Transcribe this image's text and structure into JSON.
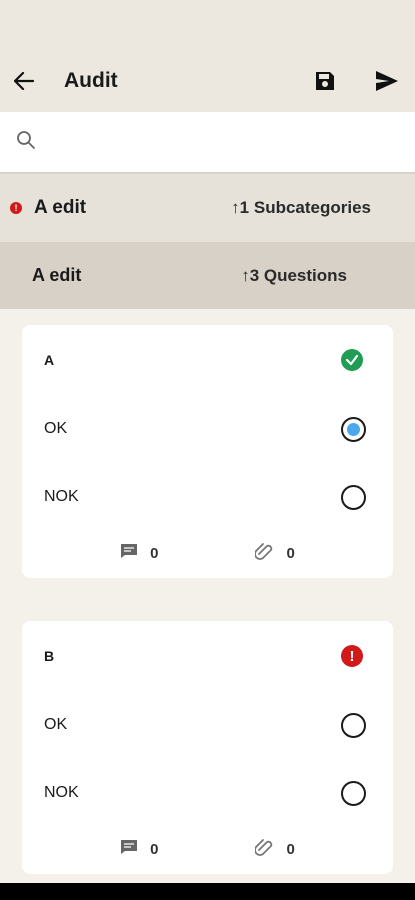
{
  "app_bar": {
    "title": "Audit"
  },
  "search": {
    "placeholder": "",
    "value": ""
  },
  "category": {
    "name": "A edit",
    "count_label": "↑1 Subcategories"
  },
  "subcategory": {
    "name": "A edit",
    "count_label": "↑3 Questions"
  },
  "questions": [
    {
      "label": "A",
      "status": "ok",
      "options": [
        {
          "label": "OK",
          "selected": true
        },
        {
          "label": "NOK",
          "selected": false
        }
      ],
      "comments": "0",
      "attachments": "0"
    },
    {
      "label": "B",
      "status": "error",
      "options": [
        {
          "label": "OK",
          "selected": false
        },
        {
          "label": "NOK",
          "selected": false
        }
      ],
      "comments": "0",
      "attachments": "0"
    }
  ],
  "colors": {
    "accent": "#4aa8ec",
    "ok": "#1f9d55",
    "error": "#d21919"
  },
  "icons": [
    "back-arrow-icon",
    "save-icon",
    "send-icon",
    "search-icon",
    "comment-icon",
    "attachment-icon"
  ]
}
